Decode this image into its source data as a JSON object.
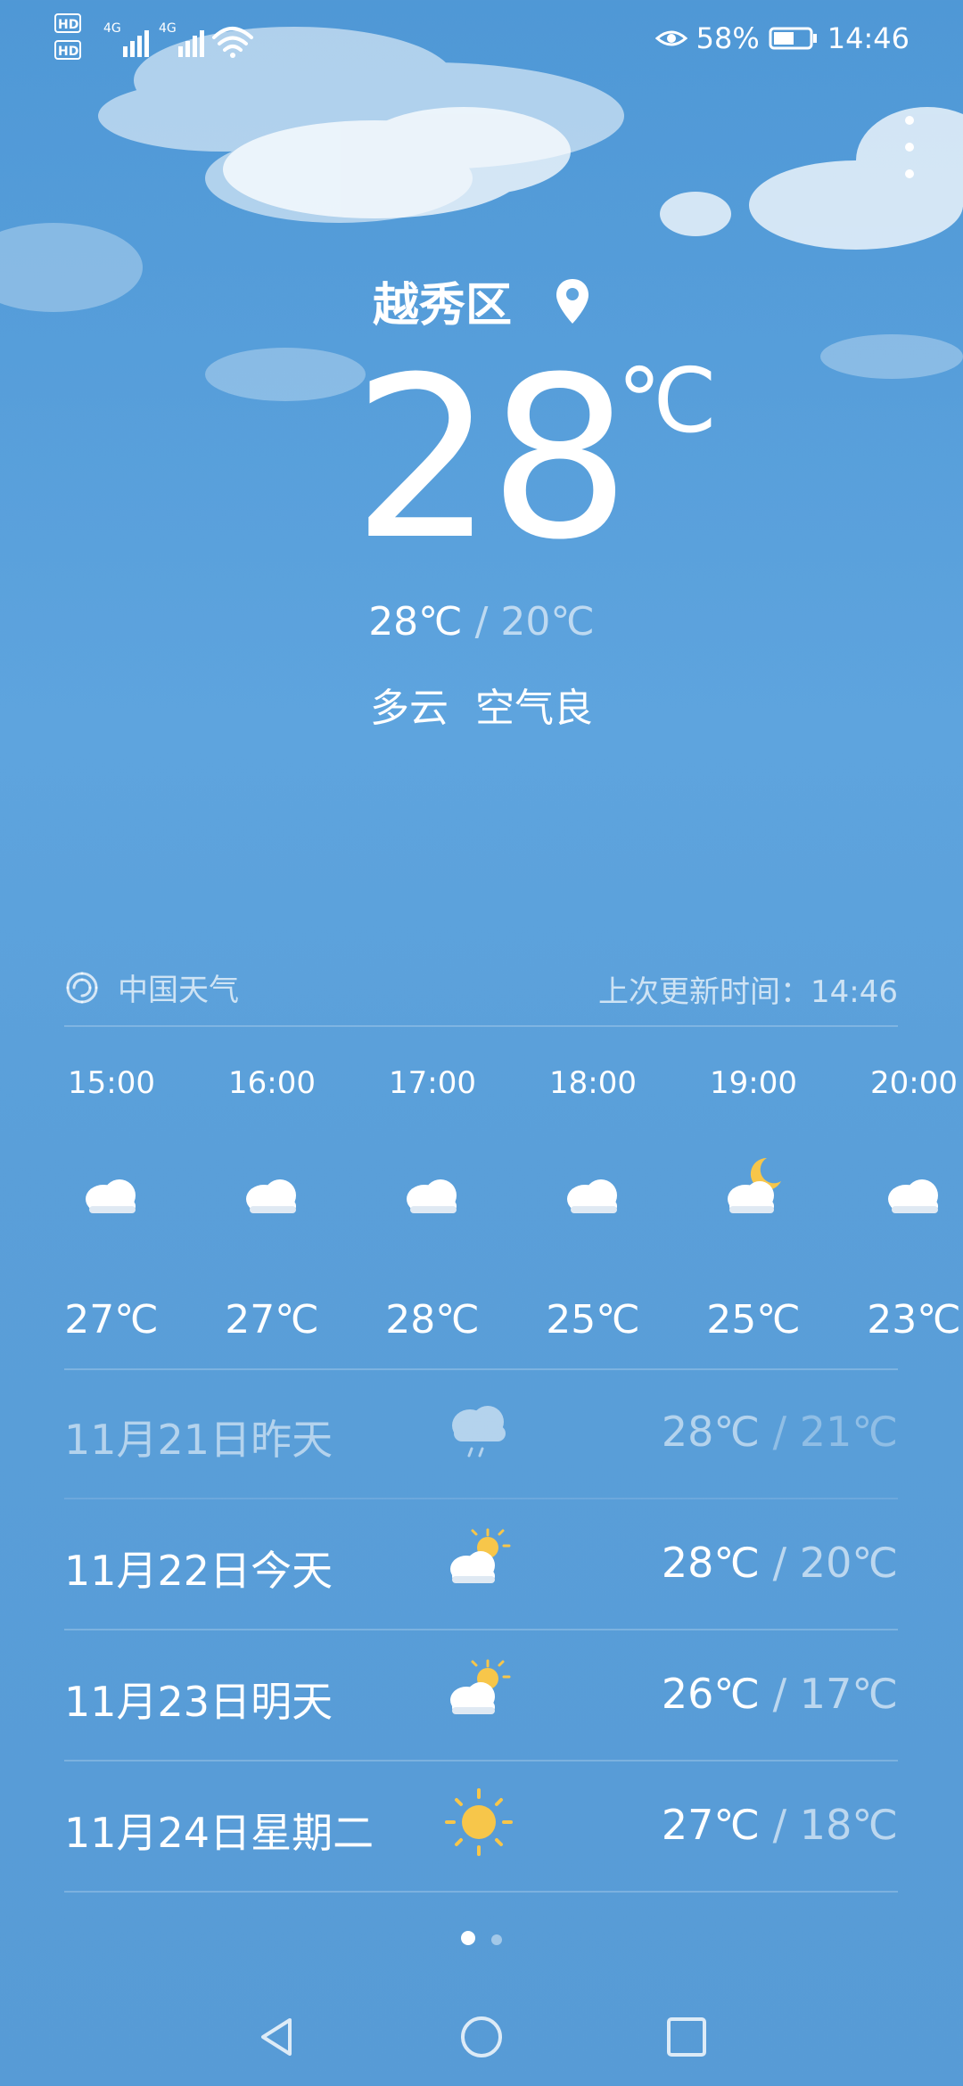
{
  "status": {
    "battery_pct": "58%",
    "time": "14:46",
    "net1": "4G",
    "net2": "4G",
    "hd1": "HD",
    "hd2": "HD"
  },
  "location": "越秀区",
  "current": {
    "temp": "28",
    "unit": "℃",
    "high": "28℃",
    "low": "20℃",
    "sep": " / ",
    "condition": "多云",
    "air": "空气良"
  },
  "source": {
    "name": "中国天气",
    "updated": "上次更新时间：14:46"
  },
  "hourly": [
    {
      "time": "15:00",
      "icon": "cloud-icon",
      "temp": "27℃"
    },
    {
      "time": "16:00",
      "icon": "cloud-icon",
      "temp": "27℃"
    },
    {
      "time": "17:00",
      "icon": "cloud-icon",
      "temp": "28℃"
    },
    {
      "time": "18:00",
      "icon": "cloud-icon",
      "temp": "25℃"
    },
    {
      "time": "19:00",
      "icon": "moon-cloud-icon",
      "temp": "25℃"
    },
    {
      "time": "20:00",
      "icon": "cloud-icon",
      "temp": "23℃"
    }
  ],
  "daily": [
    {
      "date": "11月21日昨天",
      "icon": "rain-cloud-icon",
      "high": "28℃",
      "low": "21℃"
    },
    {
      "date": "11月22日今天",
      "icon": "partly-sunny-icon",
      "high": "28℃",
      "low": "20℃"
    },
    {
      "date": "11月23日明天",
      "icon": "partly-sunny-icon",
      "high": "26℃",
      "low": "17℃"
    },
    {
      "date": "11月24日星期二",
      "icon": "sun-icon",
      "high": "27℃",
      "low": "18℃"
    }
  ],
  "temp_sep": " / ",
  "pager": {
    "count": 2,
    "active": 0
  },
  "colors": {
    "bg_top": "#4f98d6",
    "bg_bottom": "#579bd6",
    "sun": "#f7c64a"
  }
}
